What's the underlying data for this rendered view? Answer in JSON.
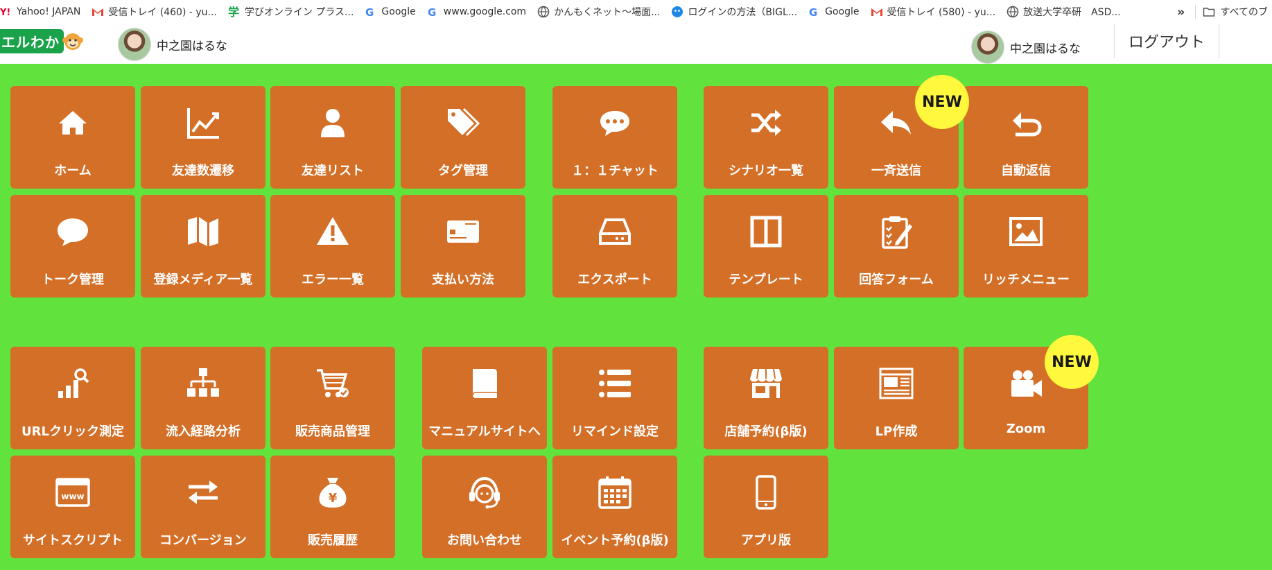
{
  "bookmarks": [
    {
      "label": "Yahoo! JAPAN",
      "icon": "yahoo-icon"
    },
    {
      "label": "受信トレイ (460) - yu...",
      "icon": "gmail-icon"
    },
    {
      "label": "学びオンライン プラス...",
      "icon": "manabi-icon"
    },
    {
      "label": "Google",
      "icon": "google-icon"
    },
    {
      "label": "www.google.com",
      "icon": "google-icon"
    },
    {
      "label": "かんもくネット〜場面...",
      "icon": "globe-icon"
    },
    {
      "label": "ログインの方法（BIGL...",
      "icon": "blue-circle-icon"
    },
    {
      "label": "Google",
      "icon": "google-icon"
    },
    {
      "label": "受信トレイ (580) - yu...",
      "icon": "gmail-icon"
    },
    {
      "label": "放送大学卒研　ASD...",
      "icon": "globe-icon"
    }
  ],
  "bookmarks_overflow": "»",
  "bookmarks_folder": "すべてのブ",
  "header": {
    "logo_text": "エルわか",
    "user_left": "中之園はるな",
    "user_right": "中之園はるな",
    "logout": "ログアウト"
  },
  "badge_text": "NEW",
  "tiles": [
    {
      "label": "ホーム",
      "icon": "home-icon"
    },
    {
      "label": "友達数遷移",
      "icon": "line-chart-icon"
    },
    {
      "label": "友達リスト",
      "icon": "user-icon"
    },
    {
      "label": "タグ管理",
      "icon": "tag-icon"
    },
    {
      "label": "１：１チャット",
      "icon": "chat-dots-icon"
    },
    {
      "label": "シナリオ一覧",
      "icon": "shuffle-icon"
    },
    {
      "label": "一斉送信",
      "icon": "reply-icon"
    },
    {
      "label": "自動返信",
      "icon": "return-arrow-icon"
    },
    {
      "label": "トーク管理",
      "icon": "speech-bubble-icon"
    },
    {
      "label": "登録メディア一覧",
      "icon": "map-icon"
    },
    {
      "label": "エラー一覧",
      "icon": "warning-icon"
    },
    {
      "label": "支払い方法",
      "icon": "credit-card-icon"
    },
    {
      "label": "エクスポート",
      "icon": "hdd-icon"
    },
    {
      "label": "テンプレート",
      "icon": "columns-icon"
    },
    {
      "label": "回答フォーム",
      "icon": "clipboard-icon"
    },
    {
      "label": "リッチメニュー",
      "icon": "image-icon"
    },
    {
      "label": "URLクリック測定",
      "icon": "bar-search-icon"
    },
    {
      "label": "流入経路分析",
      "icon": "sitemap-icon"
    },
    {
      "label": "販売商品管理",
      "icon": "cart-icon"
    },
    {
      "label": "マニュアルサイトへ",
      "icon": "book-icon"
    },
    {
      "label": "リマインド設定",
      "icon": "list-icon"
    },
    {
      "label": "店舗予約(β版)",
      "icon": "store-icon"
    },
    {
      "label": "LP作成",
      "icon": "webpage-icon"
    },
    {
      "label": "Zoom",
      "icon": "video-camera-icon"
    },
    {
      "label": "サイトスクリプト",
      "icon": "www-window-icon"
    },
    {
      "label": "コンバージョン",
      "icon": "exchange-icon"
    },
    {
      "label": "販売履歴",
      "icon": "money-bag-icon"
    },
    {
      "label": "お問い合わせ",
      "icon": "headset-icon"
    },
    {
      "label": "イベント予約(β版)",
      "icon": "calendar-icon"
    },
    {
      "label": "アプリ版",
      "icon": "smartphone-icon"
    }
  ],
  "colors": {
    "background": "#62e23c",
    "tile": "#d46f27",
    "badge": "#fff83d",
    "logo_green": "#1aa34a"
  }
}
